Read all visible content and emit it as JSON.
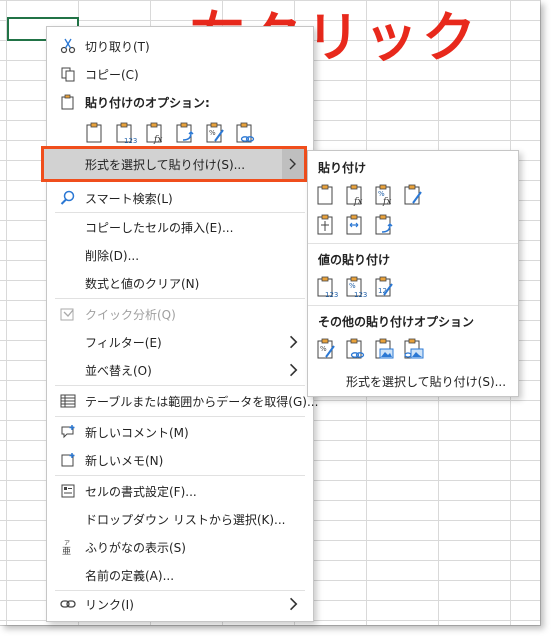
{
  "overlay_title": "右クリック",
  "menu": {
    "cut": "切り取り(T)",
    "copy": "コピー(C)",
    "paste_options_header": "貼り付けのオプション:",
    "paste_special": "形式を選択して貼り付け(S)...",
    "smart_lookup": "スマート検索(L)",
    "insert_copied": "コピーしたセルの挿入(E)...",
    "delete": "削除(D)...",
    "clear": "数式と値のクリア(N)",
    "quick_analysis": "クイック分析(Q)",
    "filter": "フィルター(E)",
    "sort": "並べ替え(O)",
    "get_data": "テーブルまたは範囲からデータを取得(G)...",
    "new_comment": "新しいコメント(M)",
    "new_note": "新しいメモ(N)",
    "format_cells": "セルの書式設定(F)...",
    "dropdown": "ドロップダウン リストから選択(K)...",
    "phonetic": "ふりがなの表示(S)",
    "define_name": "名前の定義(A)...",
    "link": "リンク(I)"
  },
  "submenu": {
    "paste_header": "貼り付け",
    "values_header": "値の貼り付け",
    "other_header": "その他の貼り付けオプション",
    "footer": "形式を選択して貼り付け(S)..."
  },
  "colors": {
    "title": "#e8291c",
    "highlight_outline": "#f04e1c",
    "excel_green": "#217346"
  }
}
